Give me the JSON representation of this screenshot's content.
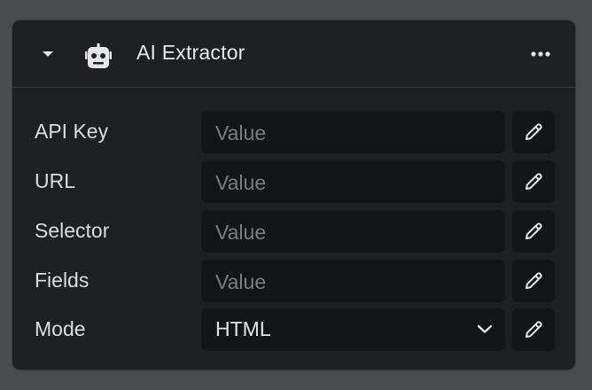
{
  "node": {
    "title": "AI Extractor",
    "icon": "robot-icon",
    "more_icon": "more-horizontal-icon",
    "collapse_icon": "caret-down-icon"
  },
  "fields": [
    {
      "label": "API Key",
      "placeholder": "Value",
      "value": ""
    },
    {
      "label": "URL",
      "placeholder": "Value",
      "value": ""
    },
    {
      "label": "Selector",
      "placeholder": "Value",
      "value": ""
    },
    {
      "label": "Fields",
      "placeholder": "Value",
      "value": ""
    }
  ],
  "mode": {
    "label": "Mode",
    "selected": "HTML"
  },
  "edit_icon": "pencil-icon",
  "colors": {
    "background": "#4a4b4f",
    "panel": "#1f2023",
    "input": "#141518",
    "text": "#e8e8ea",
    "placeholder": "#7c7d82"
  }
}
